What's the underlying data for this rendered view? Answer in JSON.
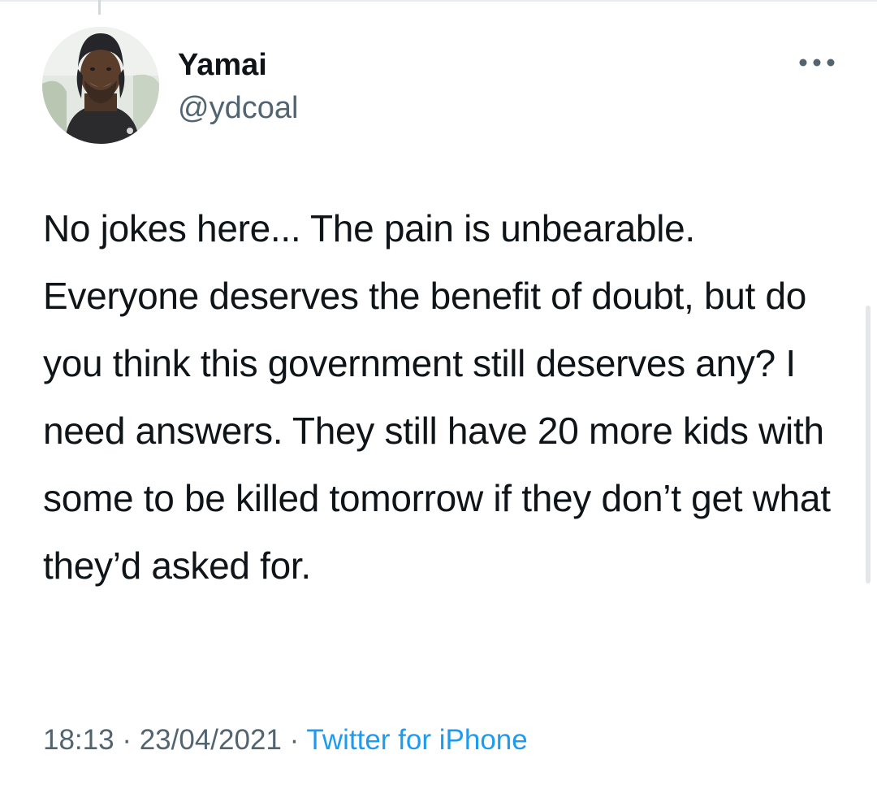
{
  "tweet": {
    "author": {
      "display_name": "Yamai",
      "handle": "@ydcoal",
      "avatar": "profile-photo"
    },
    "more_icon": "more-horizontal-icon",
    "text": "No jokes here... The pain is unbearable. Everyone deserves the benefit of doubt, but do you think this government still deserves any? I need answers. They still have 20 more kids with some to be killed tomorrow if they don’t get what they’d asked for.",
    "time": "18:13",
    "separator": "·",
    "date": "23/04/2021",
    "source": "Twitter for iPhone"
  },
  "colors": {
    "text_primary": "#0f1419",
    "text_secondary": "#536471",
    "link": "#1d9bf0",
    "background": "#ffffff"
  }
}
